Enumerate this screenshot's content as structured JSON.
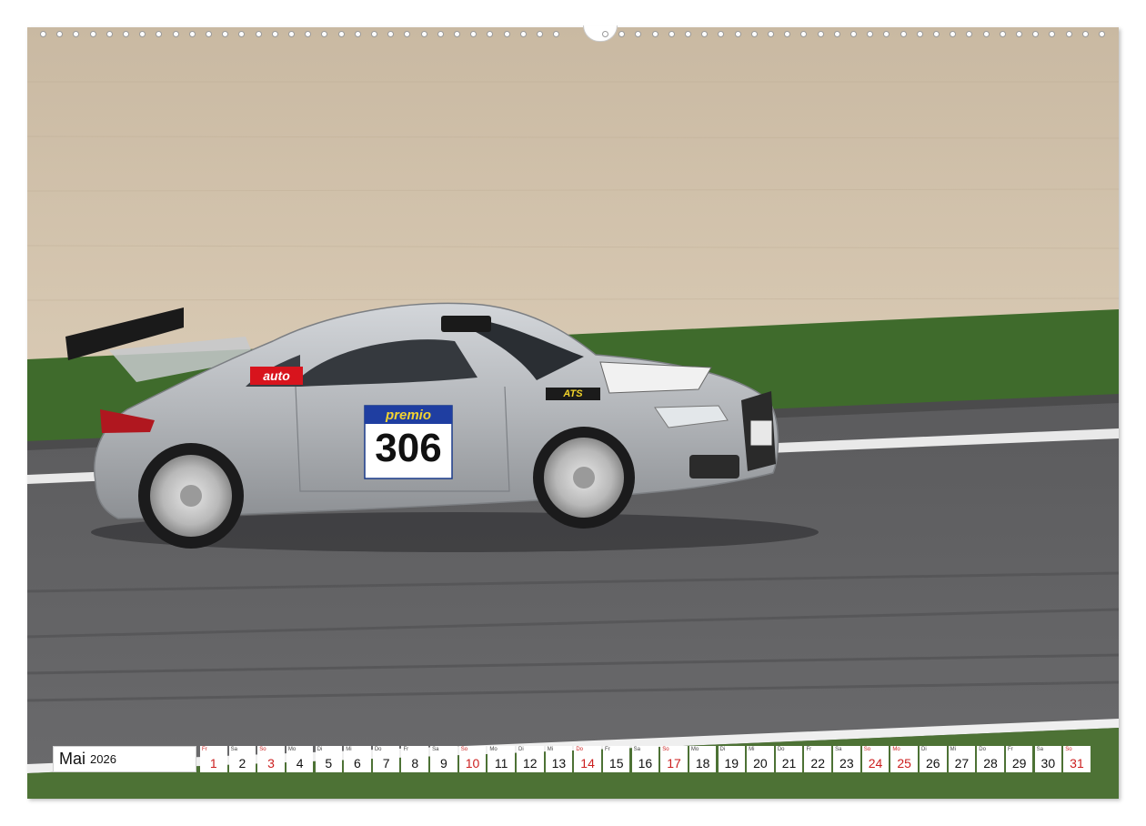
{
  "photo": {
    "subject": "race-car",
    "colors": {
      "sky_wall": "#cfbfa8",
      "grass": "#3f6b2c",
      "track": "#5a5a5c",
      "car": "#b9bcc0",
      "line": "#e8e8e8"
    },
    "decals": {
      "sponsor_top": "premio",
      "race_number": "306",
      "side_logo": "auto",
      "hood_logo": "ATS"
    }
  },
  "calendar": {
    "month": "Mai",
    "year": "2026",
    "days": [
      {
        "abbr": "Fr",
        "num": "1",
        "holiday": true
      },
      {
        "abbr": "Sa",
        "num": "2",
        "holiday": false
      },
      {
        "abbr": "So",
        "num": "3",
        "holiday": true
      },
      {
        "abbr": "Mo",
        "num": "4",
        "holiday": false
      },
      {
        "abbr": "Di",
        "num": "5",
        "holiday": false
      },
      {
        "abbr": "Mi",
        "num": "6",
        "holiday": false
      },
      {
        "abbr": "Do",
        "num": "7",
        "holiday": false
      },
      {
        "abbr": "Fr",
        "num": "8",
        "holiday": false
      },
      {
        "abbr": "Sa",
        "num": "9",
        "holiday": false
      },
      {
        "abbr": "So",
        "num": "10",
        "holiday": true
      },
      {
        "abbr": "Mo",
        "num": "11",
        "holiday": false
      },
      {
        "abbr": "Di",
        "num": "12",
        "holiday": false
      },
      {
        "abbr": "Mi",
        "num": "13",
        "holiday": false
      },
      {
        "abbr": "Do",
        "num": "14",
        "holiday": true
      },
      {
        "abbr": "Fr",
        "num": "15",
        "holiday": false
      },
      {
        "abbr": "Sa",
        "num": "16",
        "holiday": false
      },
      {
        "abbr": "So",
        "num": "17",
        "holiday": true
      },
      {
        "abbr": "Mo",
        "num": "18",
        "holiday": false
      },
      {
        "abbr": "Di",
        "num": "19",
        "holiday": false
      },
      {
        "abbr": "Mi",
        "num": "20",
        "holiday": false
      },
      {
        "abbr": "Do",
        "num": "21",
        "holiday": false
      },
      {
        "abbr": "Fr",
        "num": "22",
        "holiday": false
      },
      {
        "abbr": "Sa",
        "num": "23",
        "holiday": false
      },
      {
        "abbr": "So",
        "num": "24",
        "holiday": true
      },
      {
        "abbr": "Mo",
        "num": "25",
        "holiday": true
      },
      {
        "abbr": "Di",
        "num": "26",
        "holiday": false
      },
      {
        "abbr": "Mi",
        "num": "27",
        "holiday": false
      },
      {
        "abbr": "Do",
        "num": "28",
        "holiday": false
      },
      {
        "abbr": "Fr",
        "num": "29",
        "holiday": false
      },
      {
        "abbr": "Sa",
        "num": "30",
        "holiday": false
      },
      {
        "abbr": "So",
        "num": "31",
        "holiday": true
      }
    ]
  }
}
